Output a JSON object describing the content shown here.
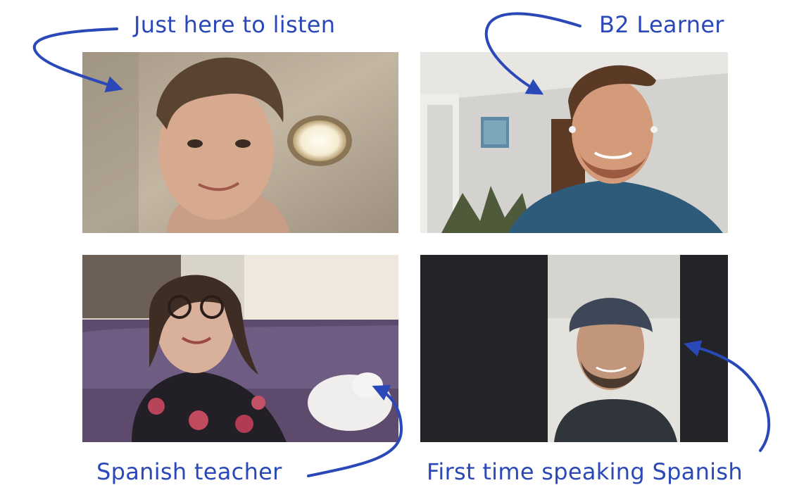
{
  "annotations": {
    "top_left": "Just here to listen",
    "top_right": "B2 Learner",
    "bottom_left": "Spanish teacher",
    "bottom_right": "First time speaking Spanish"
  },
  "colors": {
    "annotation": "#2a48b8",
    "tile_dark": "#222427"
  },
  "icons": {
    "arrows": "curved-arrow-icon"
  }
}
